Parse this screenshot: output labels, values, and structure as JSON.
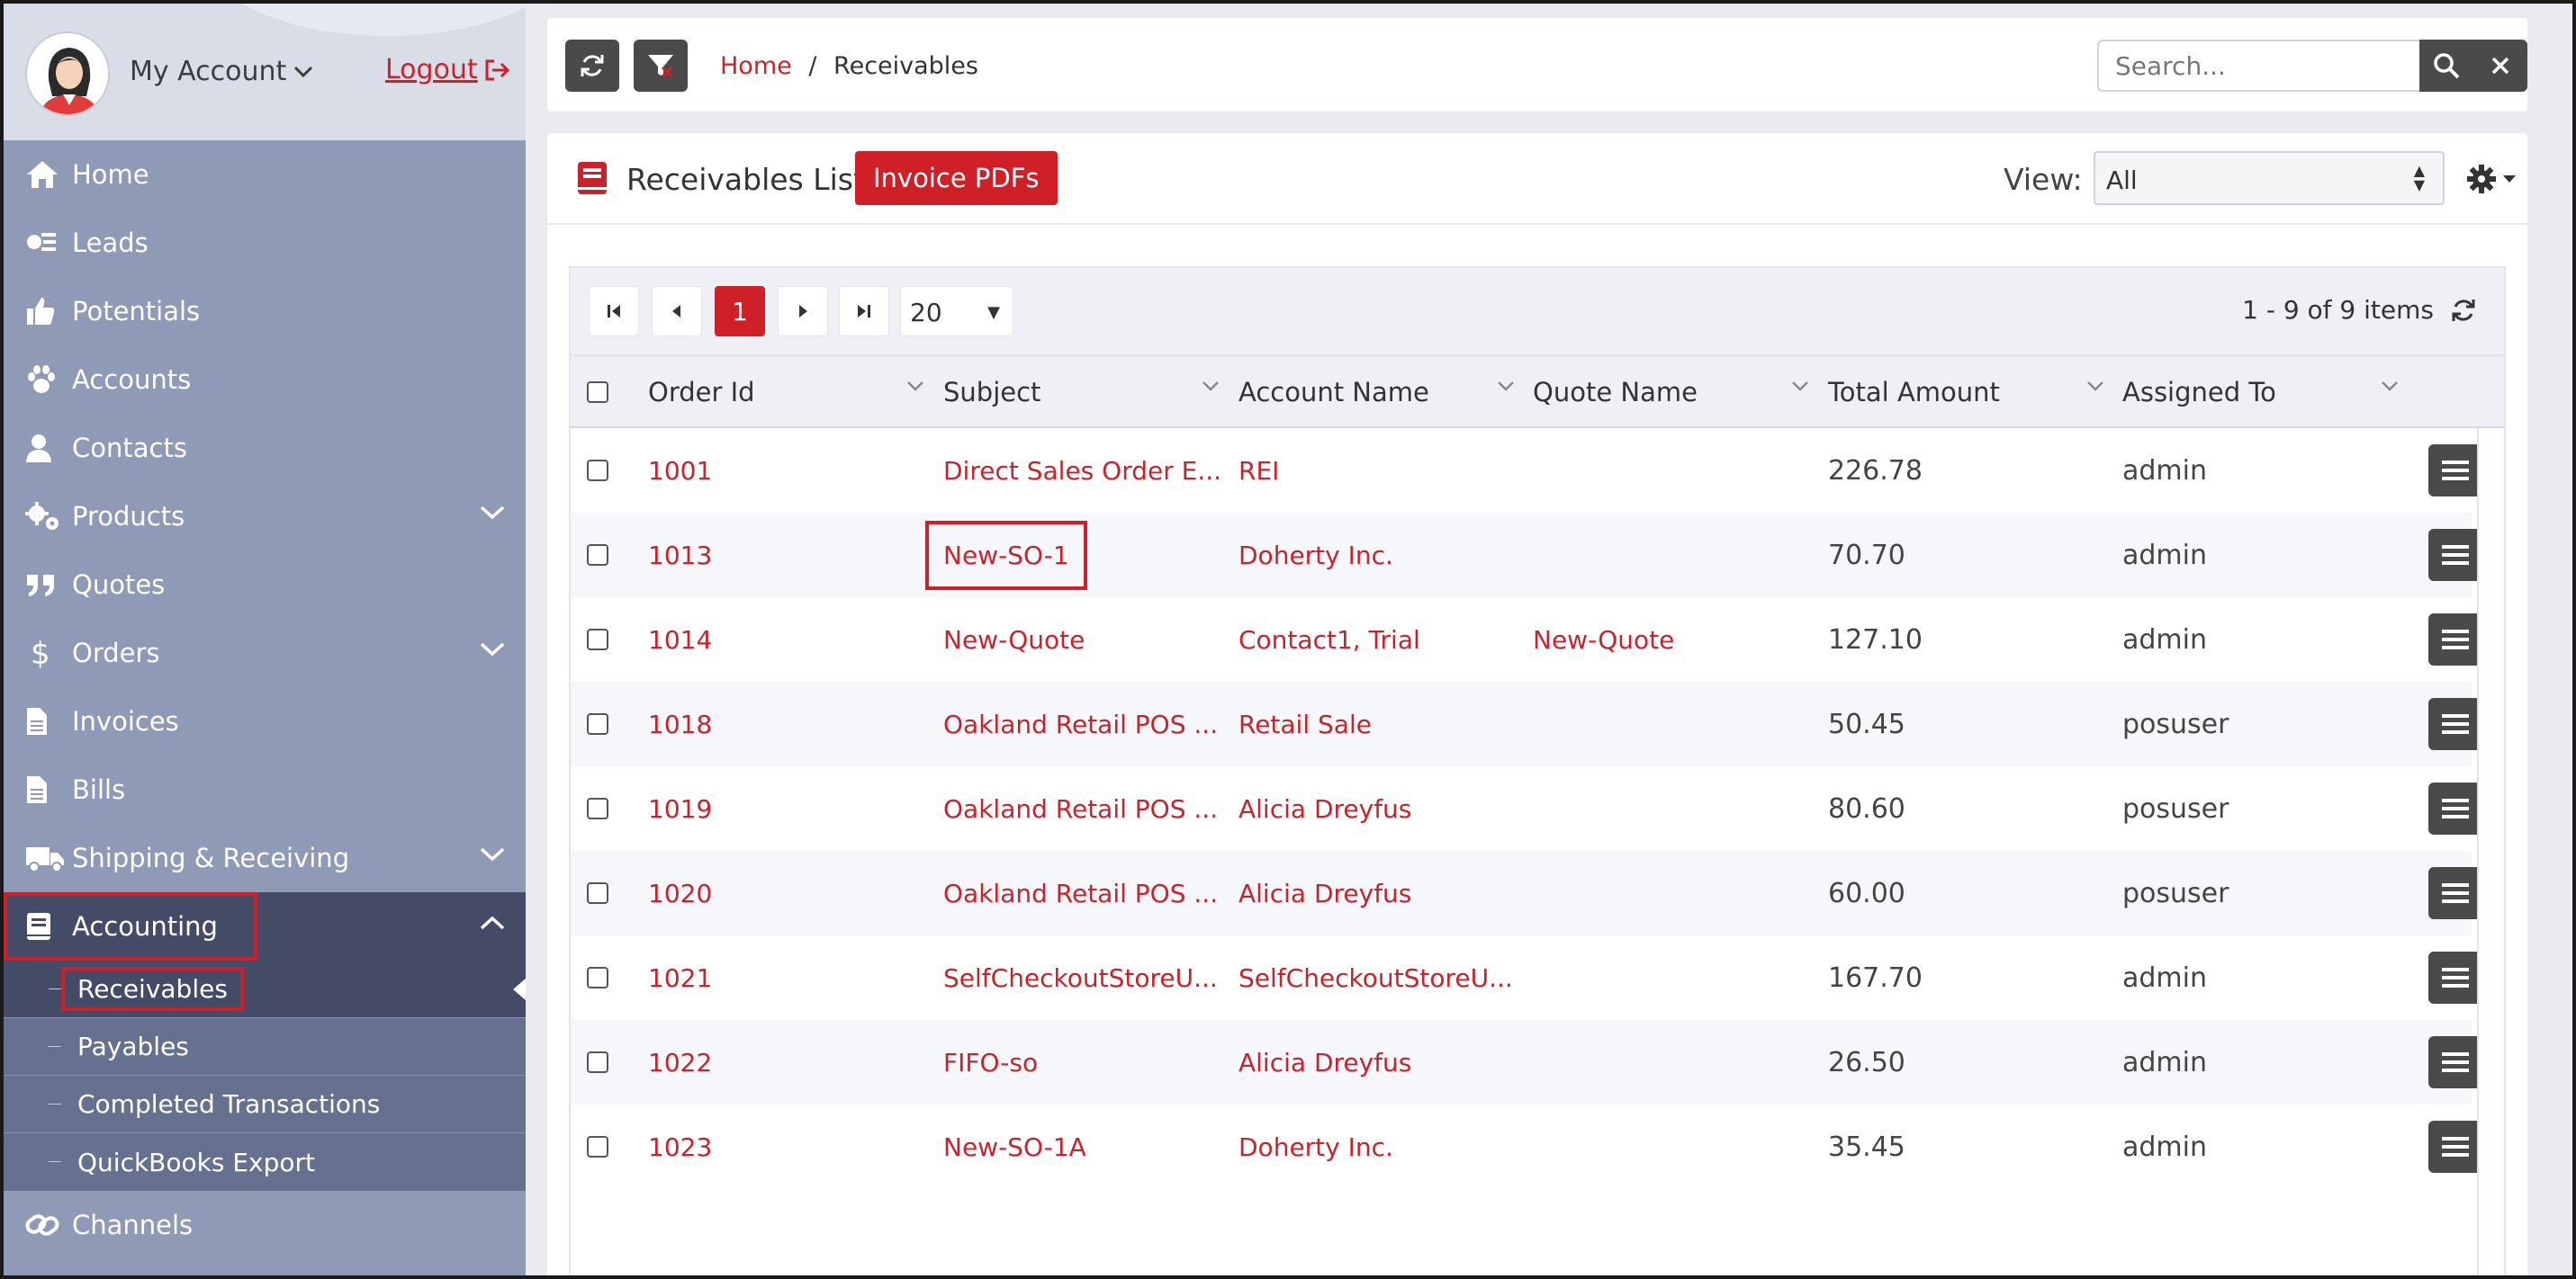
{
  "account": {
    "name": "My Account",
    "logout": "Logout"
  },
  "sidebar": {
    "items": [
      {
        "label": "Home",
        "icon": "home-icon"
      },
      {
        "label": "Leads",
        "icon": "leads-icon"
      },
      {
        "label": "Potentials",
        "icon": "thumbs-up-icon"
      },
      {
        "label": "Accounts",
        "icon": "paw-icon"
      },
      {
        "label": "Contacts",
        "icon": "user-icon"
      },
      {
        "label": "Products",
        "icon": "gears-icon"
      },
      {
        "label": "Quotes",
        "icon": "quote-icon"
      },
      {
        "label": "Orders",
        "icon": "dollar-icon"
      },
      {
        "label": "Invoices",
        "icon": "document-icon"
      },
      {
        "label": "Bills",
        "icon": "document-icon"
      },
      {
        "label": "Shipping & Receiving",
        "icon": "truck-icon"
      },
      {
        "label": "Accounting",
        "icon": "book-icon"
      },
      {
        "label": "Channels",
        "icon": "link-icon"
      }
    ],
    "accounting_sub": [
      {
        "label": "Receivables"
      },
      {
        "label": "Payables"
      },
      {
        "label": "Completed Transactions"
      },
      {
        "label": "QuickBooks Export"
      }
    ]
  },
  "breadcrumb": {
    "home": "Home",
    "separator": "/",
    "current": "Receivables"
  },
  "search": {
    "placeholder": "Search..."
  },
  "list": {
    "title": "Receivables List",
    "pdf_button": "Invoice PDFs",
    "view_label": "View:",
    "view_value": "All"
  },
  "pager": {
    "current_page": "1",
    "page_size": "20",
    "info": "1 - 9 of 9 items"
  },
  "table": {
    "columns": [
      "Order Id",
      "Subject",
      "Account Name",
      "Quote Name",
      "Total Amount",
      "Assigned To"
    ],
    "rows": [
      {
        "order_id": "1001",
        "subject": "Direct Sales Order E...",
        "account": "REI",
        "quote": "",
        "total": "226.78",
        "assigned": "admin"
      },
      {
        "order_id": "1013",
        "subject": "New-SO-1",
        "account": "Doherty Inc.",
        "quote": "",
        "total": "70.70",
        "assigned": "admin"
      },
      {
        "order_id": "1014",
        "subject": "New-Quote",
        "account": "Contact1, Trial",
        "quote": "New-Quote",
        "total": "127.10",
        "assigned": "admin"
      },
      {
        "order_id": "1018",
        "subject": "Oakland Retail POS ...",
        "account": "Retail Sale",
        "quote": "",
        "total": "50.45",
        "assigned": "posuser"
      },
      {
        "order_id": "1019",
        "subject": "Oakland Retail POS ...",
        "account": "Alicia Dreyfus",
        "quote": "",
        "total": "80.60",
        "assigned": "posuser"
      },
      {
        "order_id": "1020",
        "subject": "Oakland Retail POS ...",
        "account": "Alicia Dreyfus",
        "quote": "",
        "total": "60.00",
        "assigned": "posuser"
      },
      {
        "order_id": "1021",
        "subject": "SelfCheckoutStoreU...",
        "account": "SelfCheckoutStoreU...",
        "quote": "",
        "total": "167.70",
        "assigned": "admin"
      },
      {
        "order_id": "1022",
        "subject": "FIFO-so",
        "account": "Alicia Dreyfus",
        "quote": "",
        "total": "26.50",
        "assigned": "admin"
      },
      {
        "order_id": "1023",
        "subject": "New-SO-1A",
        "account": "Doherty Inc.",
        "quote": "",
        "total": "35.45",
        "assigned": "admin"
      }
    ]
  },
  "colors": {
    "accent": "#cf2027",
    "sidebar_bg": "#8f9ab7",
    "sidebar_active": "#434b66",
    "dark_button": "#4a4a4a"
  }
}
